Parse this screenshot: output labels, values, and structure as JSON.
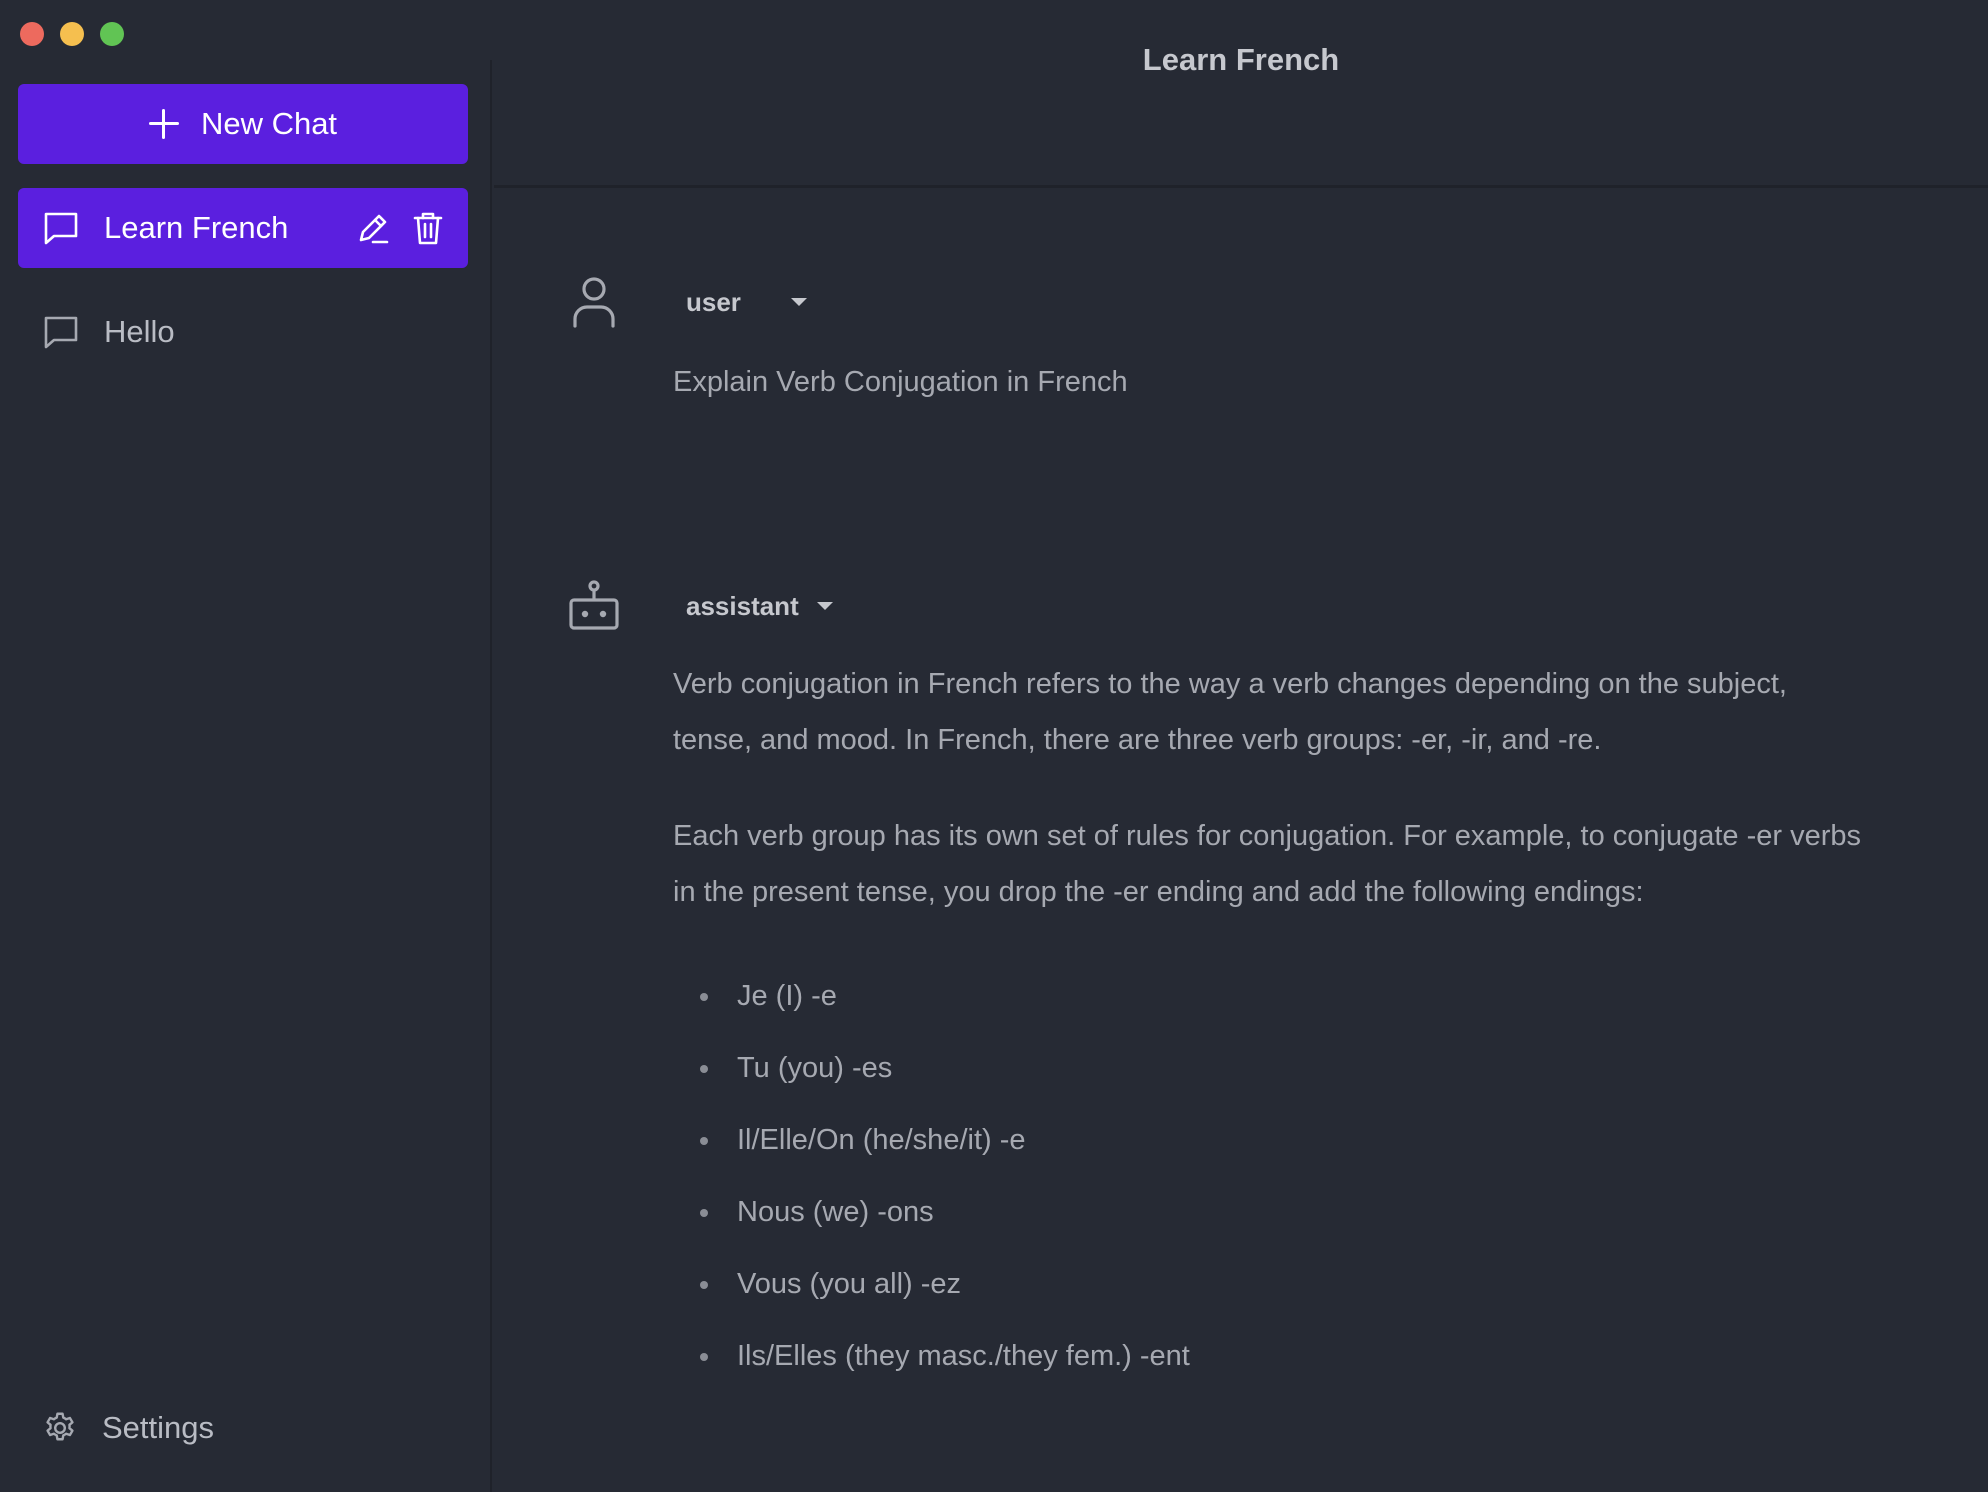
{
  "window": {
    "controls": [
      "close",
      "minimize",
      "maximize"
    ]
  },
  "sidebar": {
    "new_chat_label": "New Chat",
    "new_chat_icon": "plus-icon",
    "chats": [
      {
        "label": "Learn French",
        "active": true,
        "icon": "chat-bubble-icon",
        "actions": [
          "edit-icon",
          "trash-icon"
        ]
      },
      {
        "label": "Hello",
        "active": false,
        "icon": "chat-bubble-icon"
      }
    ],
    "settings_label": "Settings",
    "settings_icon": "gear-icon"
  },
  "main": {
    "title": "Learn French",
    "messages": [
      {
        "role": "user",
        "avatar_icon": "user-icon",
        "text": "Explain Verb Conjugation in French"
      },
      {
        "role": "assistant",
        "avatar_icon": "robot-icon",
        "paragraphs": [
          "Verb conjugation in French refers to the way a verb changes depending on the subject, tense, and mood. In French, there are three verb groups: -er, -ir, and -re.",
          "Each verb group has its own set of rules for conjugation. For example, to conjugate -er verbs in the present tense, you drop the -er ending and add the following endings:"
        ],
        "list": [
          "Je (I) -e",
          "Tu (you) -es",
          "Il/Elle/On (he/she/it) -e",
          "Nous (we) -ons",
          "Vous (you all) -ez",
          "Ils/Elles (they masc./they fem.) -ent"
        ]
      }
    ]
  },
  "colors": {
    "background": "#262a34",
    "accent": "#5b1fdf",
    "text": "#a6a9b1"
  }
}
